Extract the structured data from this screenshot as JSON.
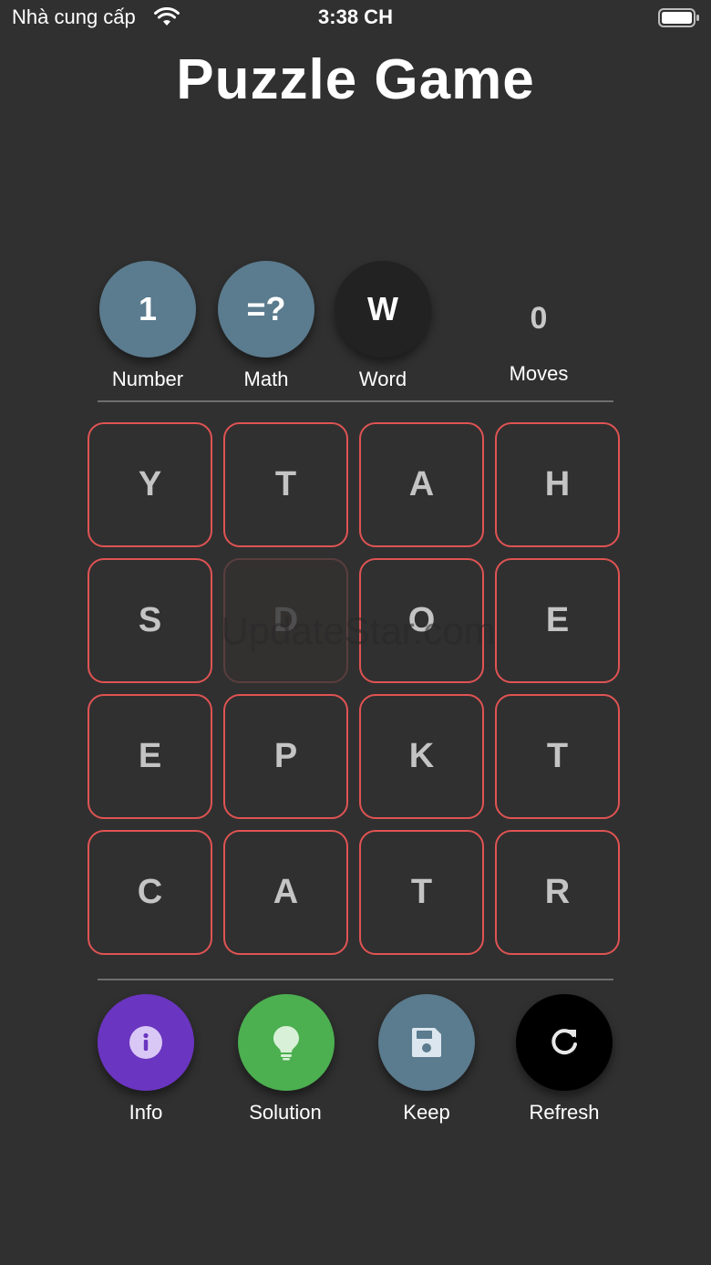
{
  "status_bar": {
    "carrier": "Nhà cung cấp",
    "time": "3:38 CH"
  },
  "app": {
    "title": "Puzzle Game"
  },
  "modes": [
    {
      "symbol": "1",
      "label": "Number",
      "color": "#5b7b8e"
    },
    {
      "symbol": "=?",
      "label": "Math",
      "color": "#5b7b8e"
    },
    {
      "symbol": "W",
      "label": "Word",
      "color": "#222222"
    }
  ],
  "moves": {
    "value": "0",
    "label": "Moves"
  },
  "board": {
    "rows": [
      [
        "Y",
        "T",
        "A",
        "H"
      ],
      [
        "S",
        "D",
        "O",
        "E"
      ],
      [
        "E",
        "P",
        "K",
        "T"
      ],
      [
        "C",
        "A",
        "T",
        "R"
      ]
    ],
    "empty_tile_letter": "D",
    "tile_border_color": "#e05353"
  },
  "watermark": "UpdateStar.com",
  "actions": [
    {
      "label": "Info",
      "icon": "info-icon",
      "color": "#6a35c0"
    },
    {
      "label": "Solution",
      "icon": "lightbulb-icon",
      "color": "#4caf50"
    },
    {
      "label": "Keep",
      "icon": "save-icon",
      "color": "#5b7b8e"
    },
    {
      "label": "Refresh",
      "icon": "refresh-icon",
      "color": "#000000"
    }
  ]
}
